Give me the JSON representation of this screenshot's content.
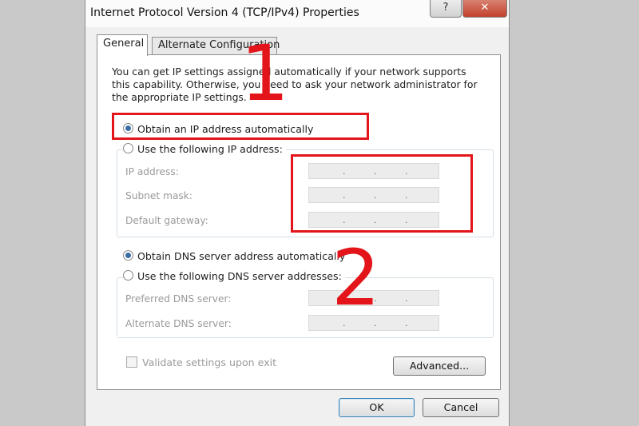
{
  "window": {
    "title": "Internet Protocol Version 4 (TCP/IPv4) Properties",
    "help_glyph": "?",
    "close_glyph": "✕"
  },
  "tabs": [
    {
      "label": "General",
      "active": true
    },
    {
      "label": "Alternate Configuration",
      "active": false
    }
  ],
  "intro_text": "You can get IP settings assigned automatically if your network supports this capability. Otherwise, you need to ask your network administrator for the appropriate IP settings.",
  "ip": {
    "auto_label": "Obtain an IP address automatically",
    "auto_selected": true,
    "manual_label": "Use the following IP address:",
    "fields": [
      {
        "label": "IP address:",
        "value": ". . ."
      },
      {
        "label": "Subnet mask:",
        "value": ". . ."
      },
      {
        "label": "Default gateway:",
        "value": ". . ."
      }
    ]
  },
  "dns": {
    "auto_label": "Obtain DNS server address automatically",
    "auto_selected": true,
    "manual_label": "Use the following DNS server addresses:",
    "fields": [
      {
        "label": "Preferred DNS server:",
        "value": ". . ."
      },
      {
        "label": "Alternate DNS server:",
        "value": ". . ."
      }
    ]
  },
  "validate": {
    "label": "Validate settings upon exit",
    "checked": false
  },
  "buttons": {
    "advanced": "Advanced...",
    "ok": "OK",
    "cancel": "Cancel"
  },
  "annotations": {
    "step1": "1",
    "step2": "2",
    "color": "#e3151a"
  }
}
